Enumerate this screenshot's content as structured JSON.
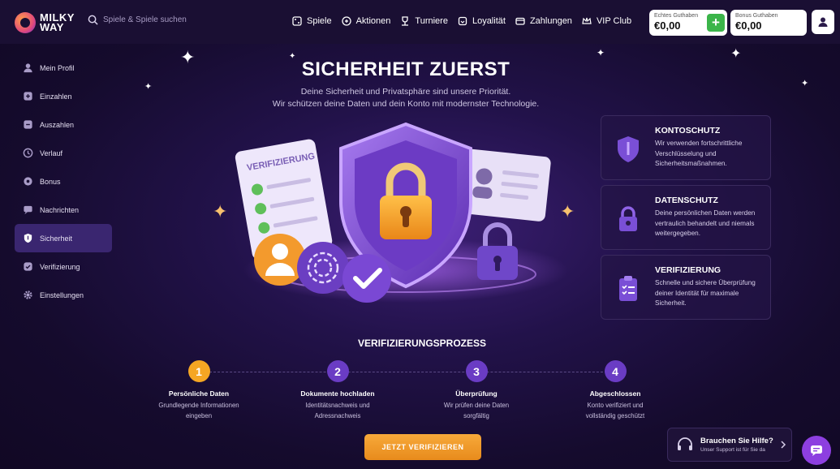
{
  "header": {
    "logo_line1": "MILKY",
    "logo_line2": "WAY",
    "search_placeholder": "Spiele & Spiele suchen",
    "nav": [
      {
        "label": "Spiele",
        "icon": "dice-icon"
      },
      {
        "label": "Aktionen",
        "icon": "gift-icon"
      },
      {
        "label": "Turniere",
        "icon": "trophy-icon"
      },
      {
        "label": "Loyalität",
        "icon": "diamond-icon"
      },
      {
        "label": "Zahlungen",
        "icon": "wallet-icon"
      },
      {
        "label": "VIP Club",
        "icon": "crown-icon"
      }
    ],
    "balance_real_label": "Echtes Guthaben",
    "balance_real_value": "€0,00",
    "balance_bonus_label": "Bonus Guthaben",
    "balance_bonus_value": "€0,00",
    "deposit_label": "+"
  },
  "sidebar": {
    "items": [
      {
        "label": "Mein Profil"
      },
      {
        "label": "Einzahlen"
      },
      {
        "label": "Auszahlen"
      },
      {
        "label": "Verlauf"
      },
      {
        "label": "Bonus"
      },
      {
        "label": "Nachrichten"
      },
      {
        "label": "Sicherheit"
      },
      {
        "label": "Verifizierung"
      },
      {
        "label": "Einstellungen"
      }
    ],
    "active_index": 6
  },
  "hero": {
    "title": "SICHERHEIT ZUERST",
    "subtitle_line1": "Deine Sicherheit und Privatsphäre sind unsere Priorität.",
    "subtitle_line2": "Wir schützen deine Daten und dein Konto mit modernster Technologie.",
    "document_label": "VERIFIZIERUNG"
  },
  "cards": [
    {
      "title": "KONTOSCHUTZ",
      "text": "Wir verwenden fortschrittliche Verschlüsselung und Sicherheitsmaßnahmen."
    },
    {
      "title": "DATENSCHUTZ",
      "text": "Deine persönlichen Daten werden vertraulich behandelt und niemals weitergegeben."
    },
    {
      "title": "VERIFIZIERUNG",
      "text": "Schnelle und sichere Überprüfung deiner Identität für maximale Sicherheit."
    }
  ],
  "process": {
    "title": "VERIFIZIERUNGSPROZESS",
    "steps": [
      {
        "num": "1",
        "title": "Persönliche Daten",
        "line1": "Grundlegende Informationen",
        "line2": "eingeben"
      },
      {
        "num": "2",
        "title": "Dokumente hochladen",
        "line1": "Identitätsnachweis und",
        "line2": "Adressnachweis"
      },
      {
        "num": "3",
        "title": "Überprüfung",
        "line1": "Wir prüfen deine Daten",
        "line2": "sorgfältig"
      },
      {
        "num": "4",
        "title": "Abgeschlossen",
        "line1": "Konto verifiziert und",
        "line2": "vollständig geschützt"
      }
    ],
    "cta_label": "JETZT VERIFIZIEREN"
  },
  "help": {
    "title": "Brauchen Sie Hilfe?",
    "subtitle": "Unser Support ist für Sie da"
  },
  "colors": {
    "accent_orange": "#f5a623",
    "accent_purple": "#6a3cc4",
    "deposit_green": "#3bb54a"
  }
}
